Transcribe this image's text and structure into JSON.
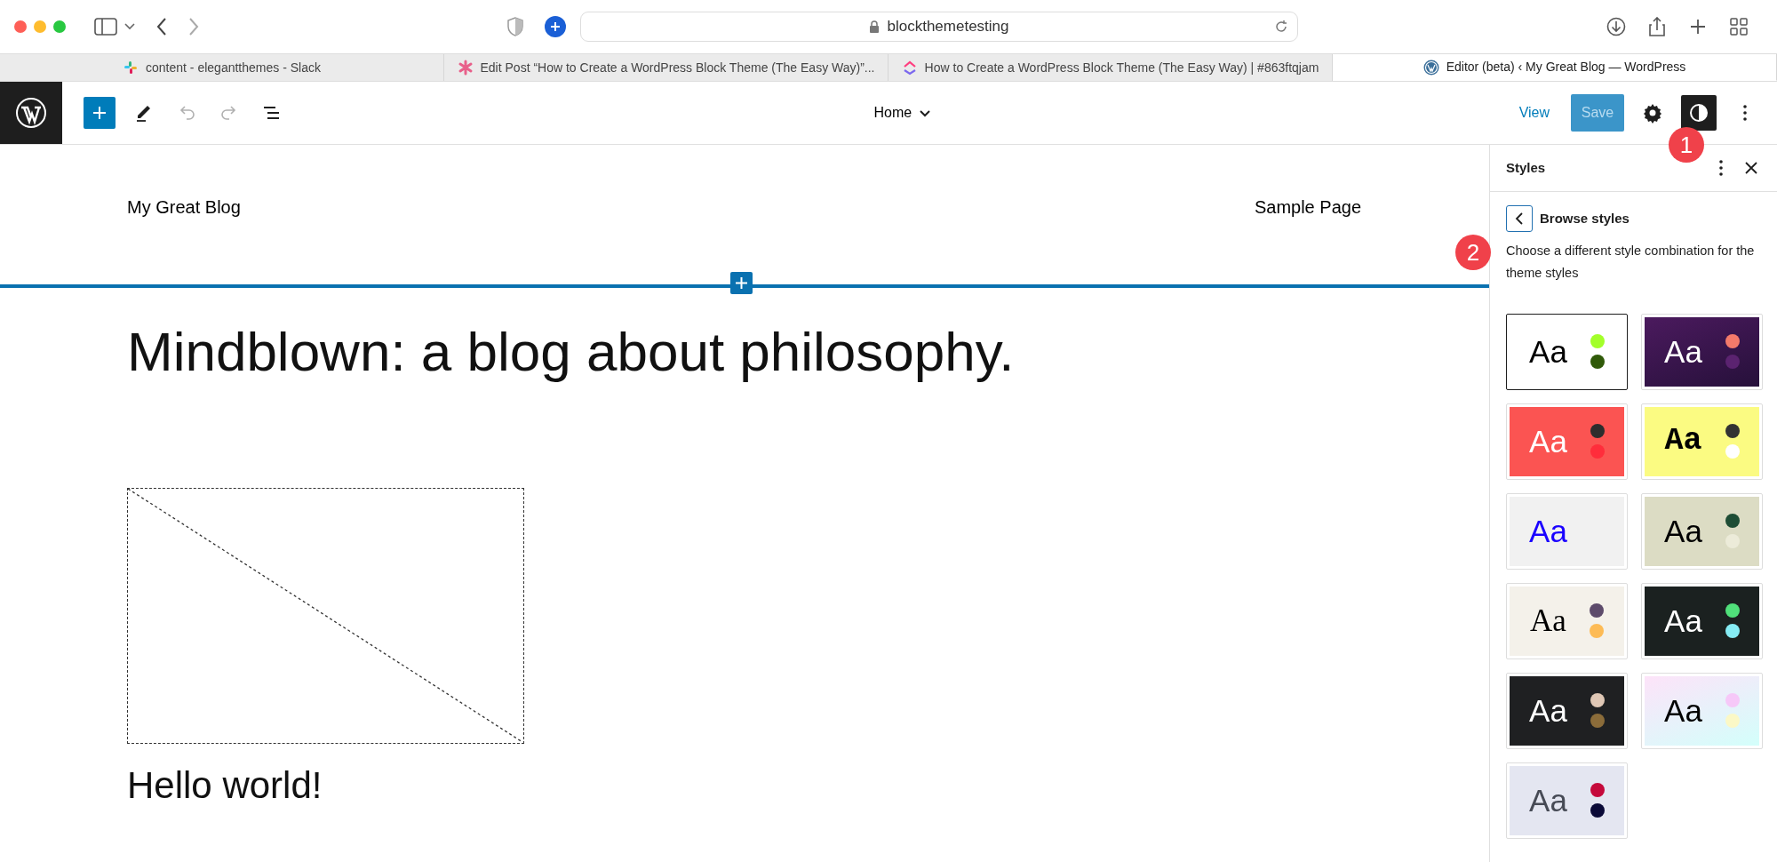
{
  "browser": {
    "url": "blockthemetesting",
    "tabs": [
      {
        "title": "content - elegantthemes - Slack",
        "kind": "pinwheel",
        "selected": false
      },
      {
        "title": "Edit Post “How to Create a WordPress Block Theme (The Easy Way)”...",
        "kind": "asterisk",
        "selected": false
      },
      {
        "title": "How to Create a WordPress Block Theme (The Easy Way) | #863ftqjam",
        "kind": "chevrons",
        "selected": false
      },
      {
        "title": "Editor (beta) ‹ My Great Blog — WordPress",
        "kind": "wordpress",
        "selected": true
      }
    ]
  },
  "toolbar": {
    "undo_disabled": true,
    "redo_disabled": true,
    "template": "Home",
    "view": "View",
    "save": "Save",
    "save_disabled": true,
    "styles_pressed": true
  },
  "canvas": {
    "site_title": "My Great Blog",
    "nav_link": "Sample Page",
    "heading": "Mindblown: a blog about philosophy.",
    "post_title": "Hello world!"
  },
  "sidebar": {
    "title": "Styles",
    "back_title": "Browse styles",
    "description": "Choose a different style combination for the theme styles",
    "variations": [
      {
        "selected": true,
        "sample": "Aa",
        "kind": "sans",
        "color": "#000000",
        "background": [
          {
            "color": "#ffffff"
          }
        ],
        "dots": [
          {
            "color": "#a3ff2a"
          },
          {
            "color": "#305a09"
          }
        ]
      },
      {
        "selected": false,
        "sample": "Aa",
        "kind": "sans",
        "color": "#ffffff",
        "background": [
          {
            "color": "#4b1a5e"
          },
          {
            "color": "#26103a"
          }
        ],
        "dots": [
          {
            "color": "#f47a6a"
          },
          {
            "color": "#5b2370"
          }
        ]
      },
      {
        "selected": false,
        "sample": "Aa",
        "kind": "sans",
        "color": "#ffffff",
        "background": [
          {
            "color": "#fb5452"
          }
        ],
        "dots": [
          {
            "color": "#2d2d2d"
          },
          {
            "color": "#ff2d3b"
          }
        ]
      },
      {
        "selected": false,
        "sample": "Aa",
        "kind": "mono",
        "color": "#000000",
        "background": [
          {
            "color": "#fbfb82"
          }
        ],
        "dots": [
          {
            "color": "#333333"
          },
          {
            "color": "#ffffff"
          }
        ]
      },
      {
        "selected": false,
        "sample": "Aa",
        "kind": "sans",
        "color": "#1a00ff",
        "background": [
          {
            "color": "#f1f1f1"
          }
        ]
      },
      {
        "selected": false,
        "sample": "Aa",
        "kind": "sans",
        "color": "#000000",
        "background": [
          {
            "color": "#dcdcc4"
          }
        ],
        "dots": [
          {
            "color": "#1e4d35"
          },
          {
            "color": "#ecebd9"
          }
        ]
      },
      {
        "selected": false,
        "sample": "Aa",
        "kind": "serif",
        "color": "#000000",
        "background": [
          {
            "color": "#f4f1ea"
          }
        ],
        "dots": [
          {
            "color": "#5d4b6b"
          },
          {
            "color": "#fdbb55"
          }
        ]
      },
      {
        "selected": false,
        "sample": "Aa",
        "kind": "sans",
        "color": "#ffffff",
        "background": [
          {
            "color": "#1b2120"
          }
        ],
        "dots": [
          {
            "color": "#50e07a"
          },
          {
            "color": "#86ecf4"
          }
        ]
      },
      {
        "selected": false,
        "sample": "Aa",
        "kind": "sans",
        "color": "#ffffff",
        "background": [
          {
            "color": "#1f2022"
          }
        ],
        "dots": [
          {
            "color": "#dfc7b5"
          },
          {
            "color": "#8b6c3a"
          }
        ]
      },
      {
        "selected": false,
        "sample": "Aa",
        "kind": "sans",
        "color": "#000000",
        "background": [
          {
            "color": "#fde3f9"
          },
          {
            "color": "#d3fffb"
          }
        ],
        "dots": [
          {
            "color": "#f6c8f8"
          },
          {
            "color": "#fbf8c6"
          }
        ]
      },
      {
        "selected": false,
        "sample": "Aa",
        "kind": "sans",
        "color": "#464a55",
        "background": [
          {
            "color": "#e4e6f1"
          }
        ],
        "dots": [
          {
            "color": "#c5093b"
          },
          {
            "color": "#0b0a38"
          }
        ]
      }
    ]
  },
  "annotations": [
    "1",
    "2"
  ]
}
